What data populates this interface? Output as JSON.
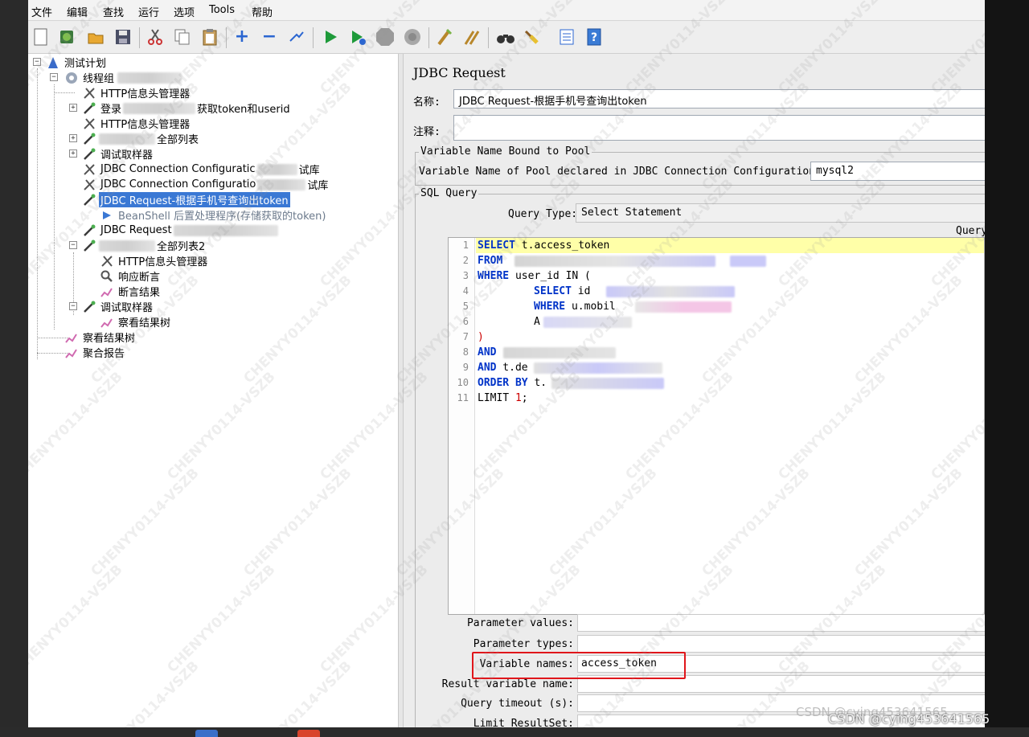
{
  "menu": [
    "文件",
    "编辑",
    "查找",
    "运行",
    "选项",
    "Tools",
    "帮助"
  ],
  "tree": {
    "items": [
      {
        "label": "测试计划",
        "icon": "test-plan-icon"
      },
      {
        "label": "线程组",
        "icon": "thread-group-icon"
      },
      {
        "label": "HTTP信息头管理器",
        "icon": "config-element-icon"
      },
      {
        "label": "登录",
        "suffix": "获取token和userid",
        "icon": "sampler-icon"
      },
      {
        "label": "HTTP信息头管理器",
        "icon": "config-element-icon"
      },
      {
        "label": "全部列表",
        "icon": "sampler-icon"
      },
      {
        "label": "调试取样器",
        "icon": "sampler-icon"
      },
      {
        "label": "JDBC Connection Configuratic",
        "suffix": "试库",
        "icon": "config-element-icon"
      },
      {
        "label": "JDBC Connection Configuratio",
        "suffix": "试库",
        "icon": "config-element-icon"
      },
      {
        "label": "JDBC Request-根据手机号查询出token",
        "icon": "sampler-icon"
      },
      {
        "label": "BeanShell 后置处理程序(存储获取的token)",
        "icon": "post-processor-icon"
      },
      {
        "label": "JDBC Request",
        "icon": "sampler-icon"
      },
      {
        "label": "全部列表2",
        "icon": "sampler-icon"
      },
      {
        "label": "HTTP信息头管理器",
        "icon": "config-element-icon"
      },
      {
        "label": "响应断言",
        "icon": "assertion-icon"
      },
      {
        "label": "断言结果",
        "icon": "listener-icon"
      },
      {
        "label": "调试取样器",
        "icon": "sampler-icon"
      },
      {
        "label": "察看结果树",
        "icon": "listener-icon"
      },
      {
        "label": "察看结果树",
        "icon": "listener-icon"
      },
      {
        "label": "聚合报告",
        "icon": "listener-icon"
      }
    ]
  },
  "panel": {
    "title": "JDBC Request",
    "name_label": "名称:",
    "name_value": "JDBC Request-根据手机号查询出token",
    "comment_label": "注释:",
    "comment_value": "",
    "pool_group_title": "Variable Name Bound to Pool",
    "pool_label": "Variable Name of Pool declared in JDBC Connection Configuration:",
    "pool_value": "mysql2",
    "sql_group_title": "SQL Query",
    "query_type_label": "Query Type:",
    "query_type_value": "Select Statement",
    "query_label": "Query:"
  },
  "sql": {
    "lines": [
      {
        "n": "1",
        "kw": "SELECT",
        "rest": " t.access_token"
      },
      {
        "n": "2",
        "kw": "FROM",
        "rest": ""
      },
      {
        "n": "3",
        "kw": "WHERE",
        "rest": " user_id IN ("
      },
      {
        "n": "4",
        "kw": "SELECT",
        "rest": " id"
      },
      {
        "n": "5",
        "kw": "WHERE",
        "rest": " u.mobil"
      },
      {
        "n": "6",
        "kw": "",
        "rest": "A"
      },
      {
        "n": "7",
        "kw": "",
        "rest": ")"
      },
      {
        "n": "8",
        "kw": "AND",
        "rest": ""
      },
      {
        "n": "9",
        "kw": "AND",
        "rest": " t.de"
      },
      {
        "n": "10",
        "kw": "ORDER BY",
        "rest": " t."
      },
      {
        "n": "11",
        "kw": "",
        "rest": "LIMIT 1;"
      }
    ]
  },
  "params": [
    {
      "label": "Parameter values:",
      "value": ""
    },
    {
      "label": "Parameter types:",
      "value": ""
    },
    {
      "label": "Variable names:",
      "value": "access_token"
    },
    {
      "label": "Result variable name:",
      "value": ""
    },
    {
      "label": "Query timeout (s):",
      "value": ""
    },
    {
      "label": "Limit ResultSet:",
      "value": ""
    }
  ],
  "watermark": {
    "text": "CSDN @cying453641565"
  },
  "colors": {
    "selection": "#3a78d4",
    "keyword": "#0033c8",
    "highlight": "#ffffa8",
    "annotation": "#e0161b"
  }
}
